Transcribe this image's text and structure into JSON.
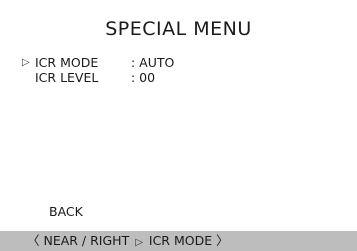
{
  "menu": {
    "title": "SPECIAL MENU",
    "items": [
      {
        "label": "ICR MODE",
        "value": ": AUTO",
        "selected": true
      },
      {
        "label": "ICR LEVEL",
        "value": ": 00",
        "selected": false
      }
    ],
    "cursor_glyph": "▷",
    "back_label": "BACK"
  },
  "status_bar": {
    "left": "〈 NEAR / RIGHT",
    "separator": "▷",
    "right": "ICR MODE 〉"
  },
  "colors": {
    "background": "#ffffff",
    "text": "#1a1a1a",
    "status_bar": "#bdbdbd"
  }
}
